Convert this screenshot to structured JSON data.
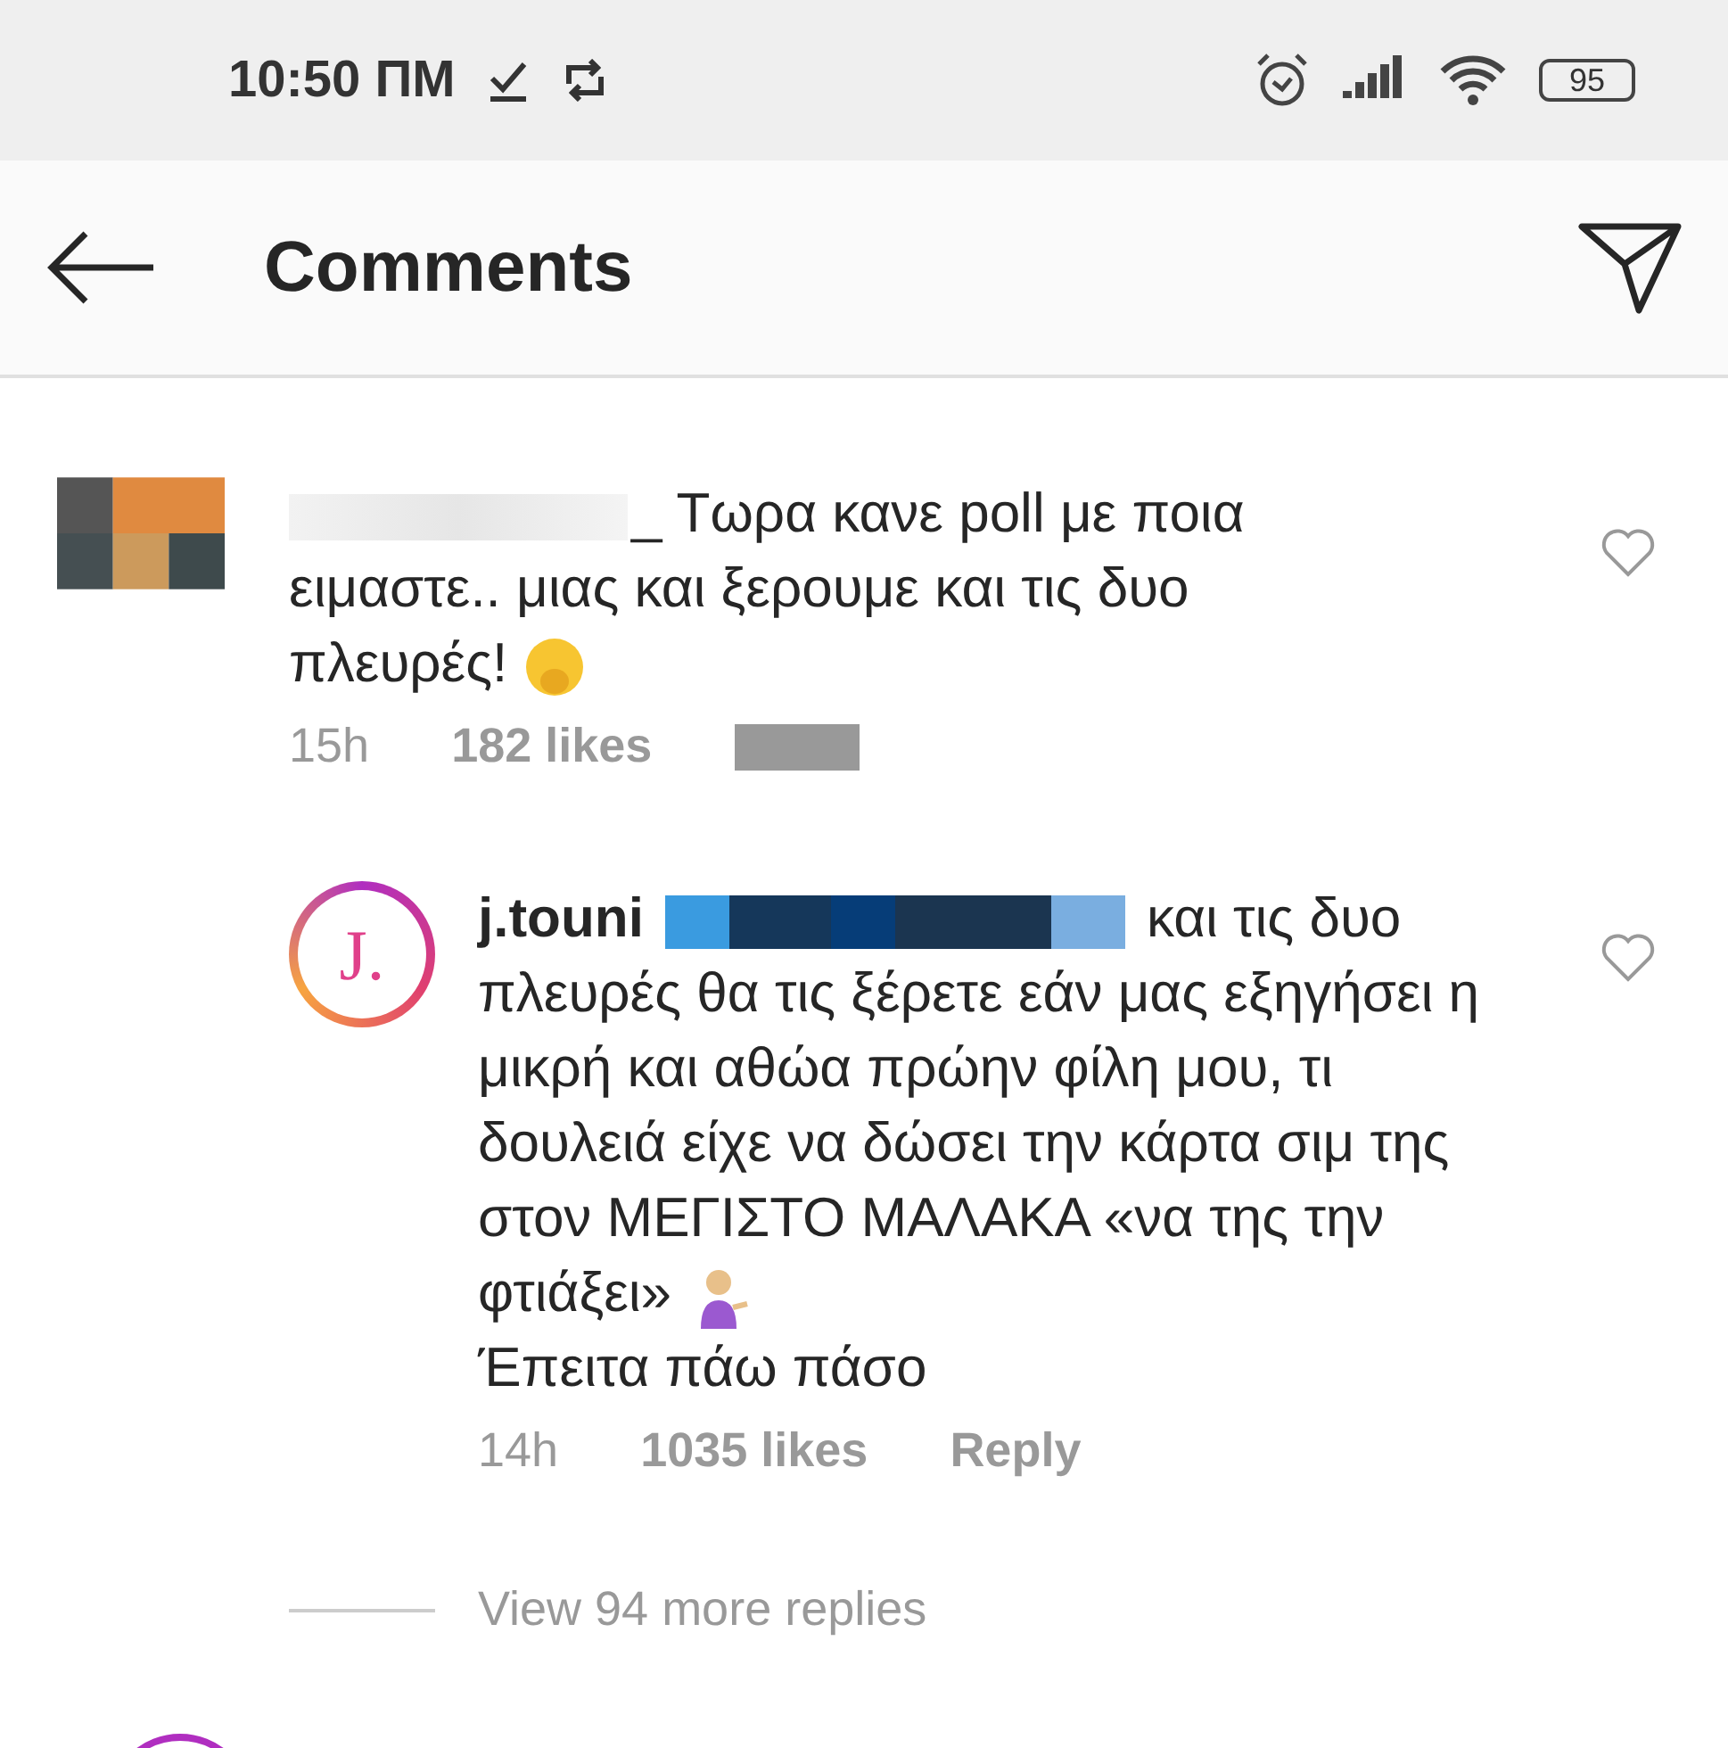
{
  "status_bar": {
    "time": "10:50 ΠΜ",
    "battery": "95"
  },
  "header": {
    "title": "Comments"
  },
  "comments": [
    {
      "kind": "comment",
      "name_hidden": true,
      "text": "_ Τωρα κανε poll με ποια ειμαστε.. μιας και ξερουμε και τις δυο πλευρές!",
      "time": "15h",
      "likes": "182 likes",
      "reply_hidden": true,
      "liked": false
    },
    {
      "kind": "reply",
      "username": "j.touni",
      "avatar_letter": "J.",
      "mention_hidden": true,
      "text": "και τις δυο πλευρές θα τις ξέρετε εάν μας εξηγήσει η μικρή και αθώα πρώην φίλη μου, τι δουλειά είχε να δώσει την κάρτα σιμ της στον ΜΕΓΙΣΤΟ ΜΑΛΑΚΑ «να της την φτιάξει»",
      "text_after": "Έπειτα πάω πάσο",
      "time": "14h",
      "likes": "1035 likes",
      "reply": "Reply",
      "liked": false
    }
  ],
  "view_replies": "View 94 more replies"
}
